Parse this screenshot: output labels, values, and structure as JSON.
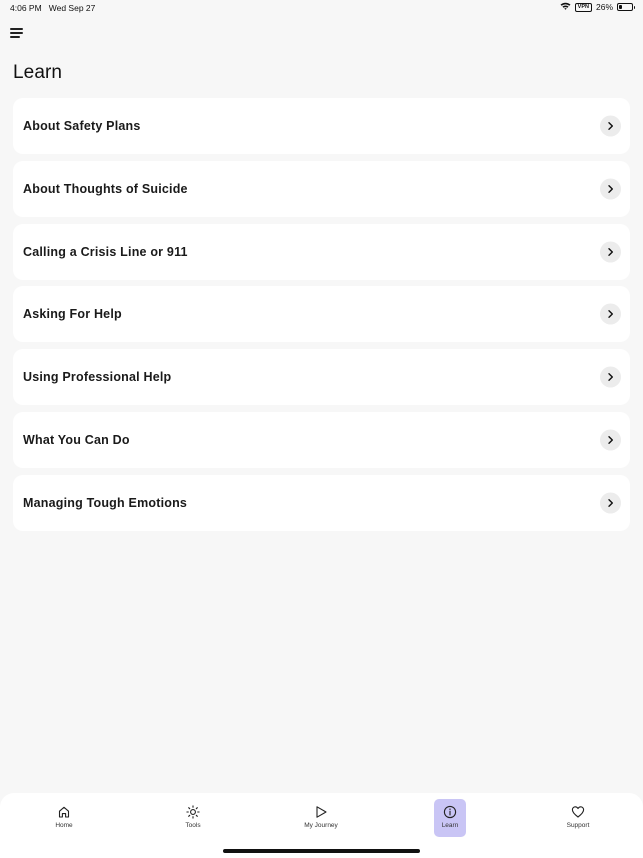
{
  "status": {
    "time": "4:06 PM",
    "date": "Wed Sep 27",
    "vpn": "VPN",
    "battery": "26%",
    "battery_level": 0.26
  },
  "header": {
    "menu_icon": "hamburger-icon",
    "title": "Learn"
  },
  "learn_items": [
    {
      "label": "About Safety Plans"
    },
    {
      "label": "About Thoughts of Suicide"
    },
    {
      "label": "Calling a Crisis Line or 911"
    },
    {
      "label": "Asking For Help"
    },
    {
      "label": "Using Professional Help"
    },
    {
      "label": "What You Can Do"
    },
    {
      "label": "Managing Tough Emotions"
    }
  ],
  "tabbar": {
    "active_color": "#c9c5f5",
    "tabs": [
      {
        "label": "Home",
        "icon": "home-icon"
      },
      {
        "label": "Tools",
        "icon": "sun-icon"
      },
      {
        "label": "My Journey",
        "icon": "play-icon"
      },
      {
        "label": "Learn",
        "icon": "info-icon",
        "active": true
      },
      {
        "label": "Support",
        "icon": "heart-icon"
      }
    ]
  }
}
